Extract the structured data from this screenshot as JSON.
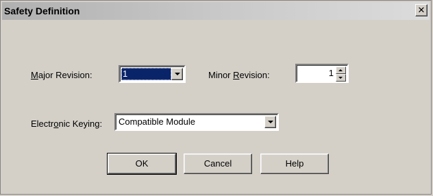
{
  "window": {
    "title": "Safety Definition",
    "close_glyph": "✕"
  },
  "major_revision": {
    "label_prefix": "",
    "label_mnemonic": "M",
    "label_rest": "ajor Revision:",
    "value": "1"
  },
  "minor_revision": {
    "label_prefix": "Minor ",
    "label_mnemonic": "R",
    "label_rest": "evision:",
    "value": "1"
  },
  "electronic_keying": {
    "label_prefix": "Electr",
    "label_mnemonic": "o",
    "label_rest": "nic Keying:",
    "value": "Compatible Module"
  },
  "buttons": {
    "ok": "OK",
    "cancel": "Cancel",
    "help": "Help"
  },
  "icons": {
    "close": "close-icon",
    "dropdown": "chevron-down-icon",
    "spin_up": "spin-up-icon",
    "spin_down": "spin-down-icon"
  },
  "colors": {
    "dialog_bg": "#d4d0c8",
    "selection_bg": "#0a246a",
    "selection_fg": "#ffffff"
  }
}
